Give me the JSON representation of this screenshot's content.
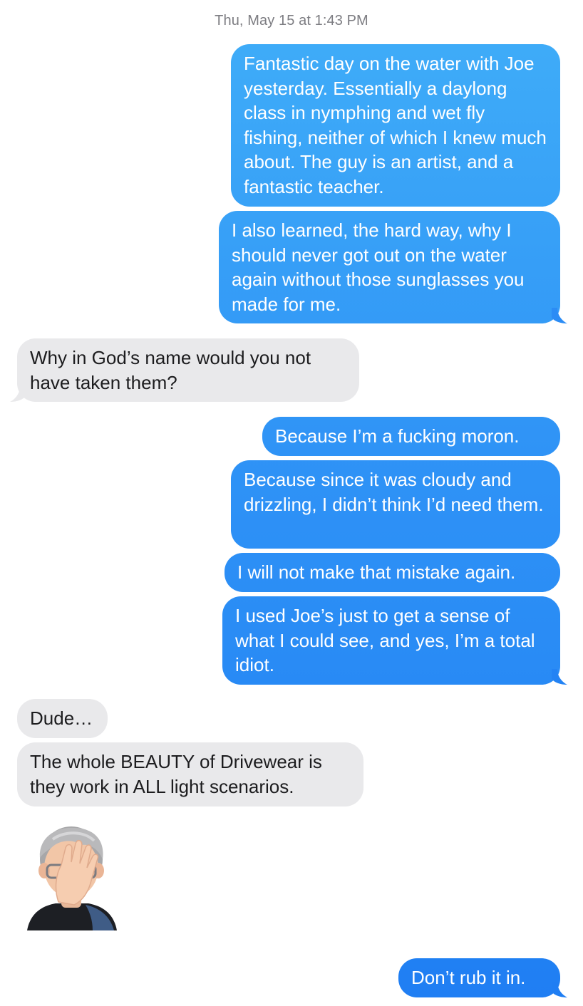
{
  "conversation": {
    "timestamp": "Thu, May 15 at 1:43 PM",
    "messages": [
      {
        "id": "m1",
        "direction": "sent",
        "text": "Fantastic day on the water with Joe yesterday. Essentially a daylong class in nymphing and wet fly fishing, neither of which I knew much about. The guy is an artist, and a fantastic teacher."
      },
      {
        "id": "m2",
        "direction": "sent",
        "text": "I also learned, the hard way, why I should never got out on the water again without those sunglasses you made for me."
      },
      {
        "id": "m3",
        "direction": "received",
        "text": "Why in God’s name would you not have taken them?"
      },
      {
        "id": "m4",
        "direction": "sent",
        "text": "Because I’m a fucking moron."
      },
      {
        "id": "m5",
        "direction": "sent",
        "text": "Because since it was cloudy and drizzling, I didn’t think I’d need them."
      },
      {
        "id": "m6",
        "direction": "sent",
        "text": "I will not make that mistake again."
      },
      {
        "id": "m7",
        "direction": "sent",
        "text": "I used Joe’s just to get a sense of what I could see, and yes, I’m a total idiot."
      },
      {
        "id": "m8",
        "direction": "received",
        "text": "Dude…"
      },
      {
        "id": "m9",
        "direction": "received",
        "text": "The whole BEAUTY of Drivewear is they work in ALL light scenarios."
      },
      {
        "id": "m10",
        "direction": "received",
        "sticker": "facepalm-memoji-sticker"
      },
      {
        "id": "m11",
        "direction": "sent",
        "text": "Don’t rub it in."
      }
    ]
  },
  "colors": {
    "sent_bubble_top": "#40aef8",
    "sent_bubble_bottom": "#1f7ef3",
    "received_bubble": "#e9e9eb",
    "received_text": "#1c1c1e",
    "timestamp_text": "#7d7d82"
  }
}
